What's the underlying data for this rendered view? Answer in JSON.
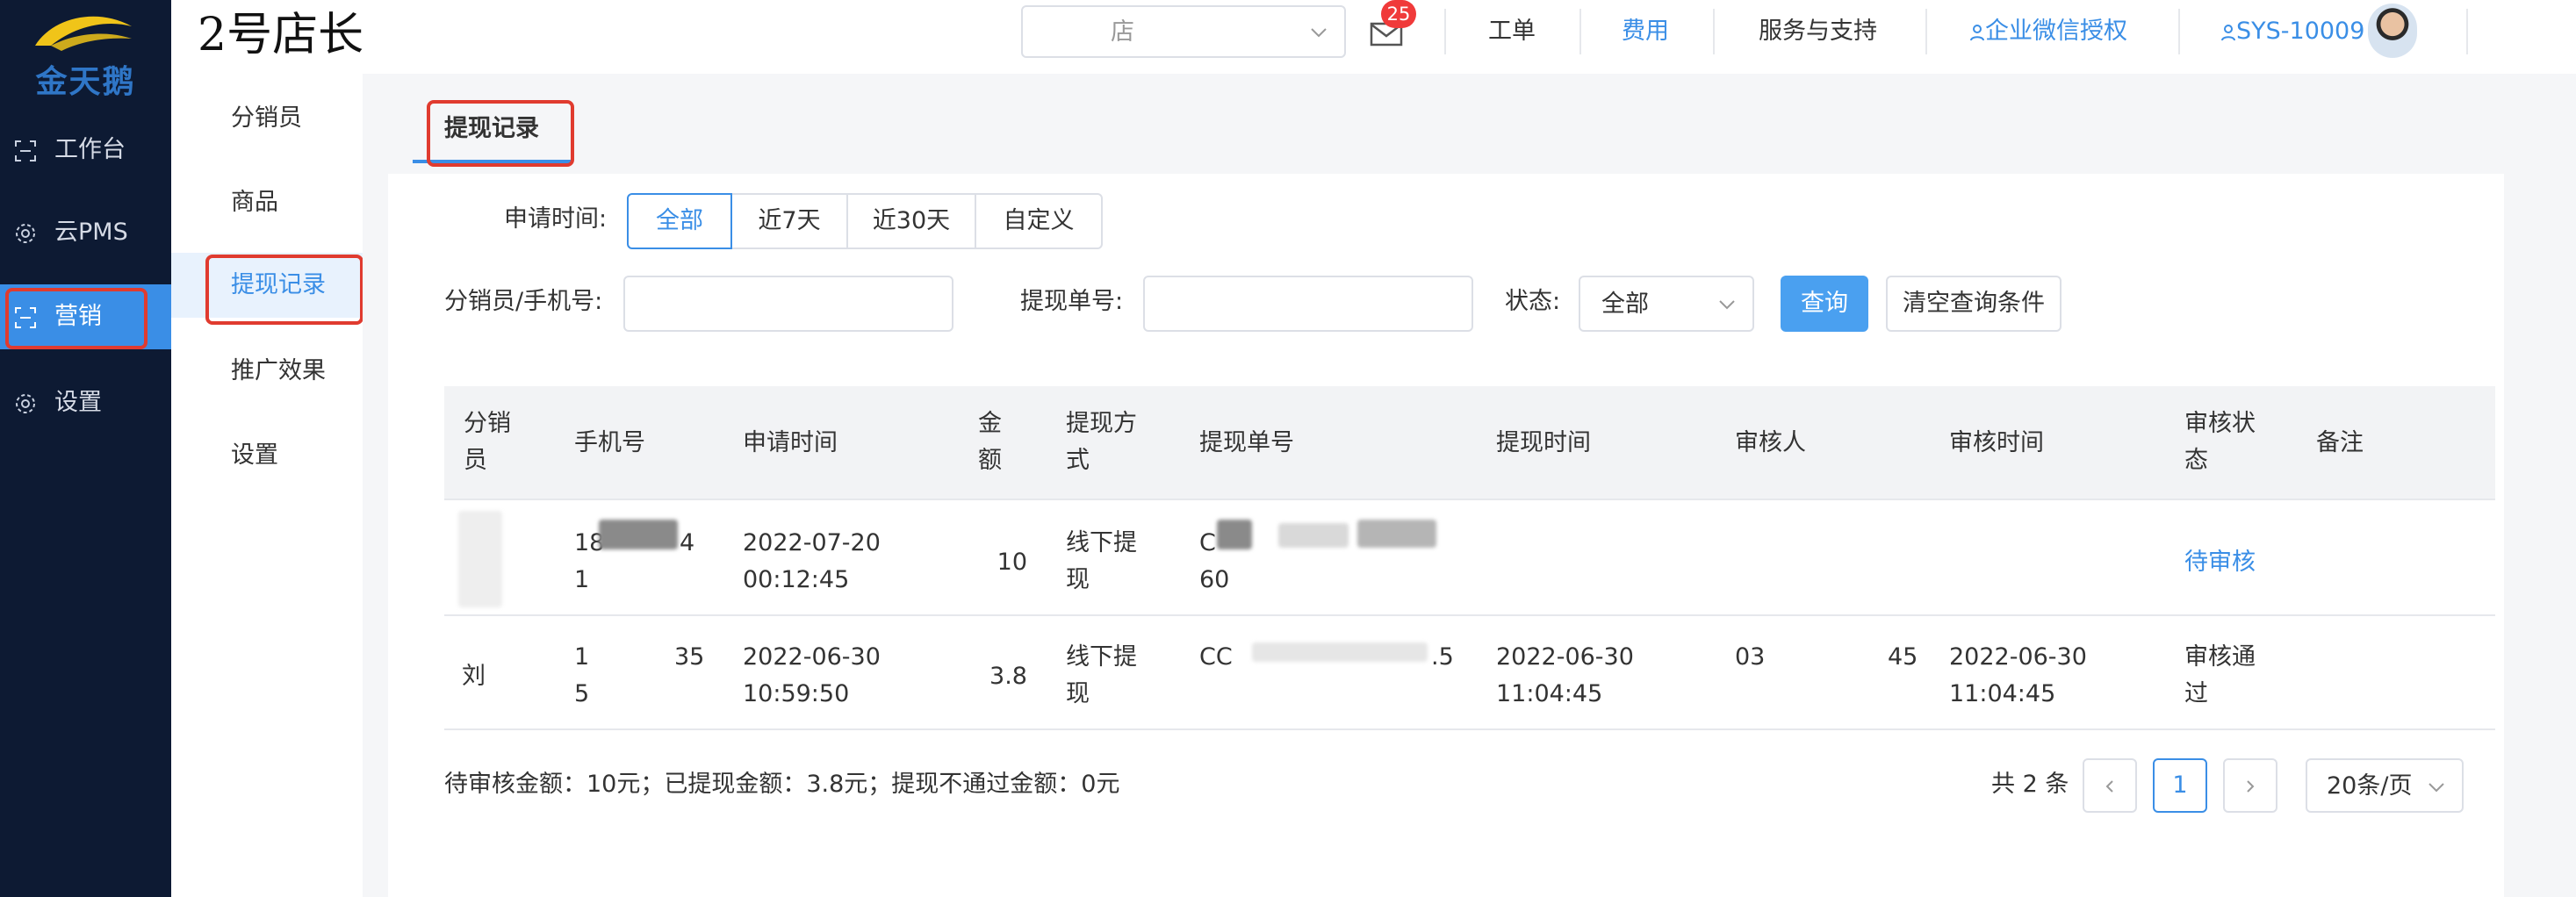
{
  "brand": {
    "name": "金天鹅",
    "color": "#2f76c7"
  },
  "app_title": "2号店长",
  "sidebar": {
    "items": [
      {
        "label": "工作台",
        "icon": "workbench-icon"
      },
      {
        "label": "云PMS",
        "icon": "gear-icon"
      },
      {
        "label": "营销",
        "icon": "marketing-icon",
        "active": true
      },
      {
        "label": "设置",
        "icon": "gear-icon"
      }
    ]
  },
  "header": {
    "store_select_value": "店",
    "mail_badge": "25",
    "links": {
      "ticket": "工单",
      "fees": "费用",
      "service": "服务与支持",
      "wecom": "企业微信授权",
      "user": "SYS-10009"
    }
  },
  "submenu": {
    "items": [
      {
        "label": "分销员"
      },
      {
        "label": "商品"
      },
      {
        "label": "提现记录",
        "active": true
      },
      {
        "label": "推广效果"
      },
      {
        "label": "设置"
      }
    ]
  },
  "tab": {
    "label": "提现记录"
  },
  "filters": {
    "time_label": "申请时间:",
    "time_options": [
      "全部",
      "近7天",
      "近30天",
      "自定义"
    ],
    "time_selected": "全部",
    "distributor_label": "分销员/手机号:",
    "distributor_value": "",
    "order_label": "提现单号:",
    "order_value": "",
    "status_label": "状态:",
    "status_value": "全部",
    "search_button": "查询",
    "clear_button": "清空查询条件"
  },
  "table": {
    "columns": [
      "分销员",
      "手机号",
      "申请时间",
      "金额",
      "提现方式",
      "提现单号",
      "提现时间",
      "审核人",
      "审核时间",
      "审核状态",
      "备注"
    ],
    "rows": [
      {
        "distributor": "",
        "phone_a": "18",
        "phone_b": "4",
        "phone_c": "1",
        "apply_date": "2022-07-20",
        "apply_time": "00:12:45",
        "amount": "10",
        "method_a": "线下提",
        "method_b": "现",
        "order_a": "C",
        "order_b": "60",
        "withdraw_date": "",
        "withdraw_time": "",
        "reviewer": "",
        "review_date": "",
        "review_time": "",
        "status_a": "待审核",
        "status_b": "",
        "note": ""
      },
      {
        "distributor": "刘",
        "phone_a": "1",
        "phone_b": "35",
        "phone_c": "5",
        "apply_date": "2022-06-30",
        "apply_time": "10:59:50",
        "amount": "3.8",
        "method_a": "线下提",
        "method_b": "现",
        "order_a": "CC",
        "order_b": ".5",
        "withdraw_date": "2022-06-30",
        "withdraw_time": "11:04:45",
        "reviewer_a": "03",
        "reviewer_b": "45",
        "review_date": "2022-06-30",
        "review_time": "11:04:45",
        "status_a": "审核通",
        "status_b": "过",
        "note": ""
      }
    ]
  },
  "footer": {
    "summary": "待审核金额：10元；已提现金额：3.8元；提现不通过金额：0元",
    "total": "共 2 条",
    "current_page": "1",
    "page_size": "20条/页"
  },
  "colors": {
    "accent": "#3a8ee6",
    "sidebar_bg": "#0d1a33",
    "highlight_box": "#e03b2f",
    "badge": "#f03a3a"
  }
}
